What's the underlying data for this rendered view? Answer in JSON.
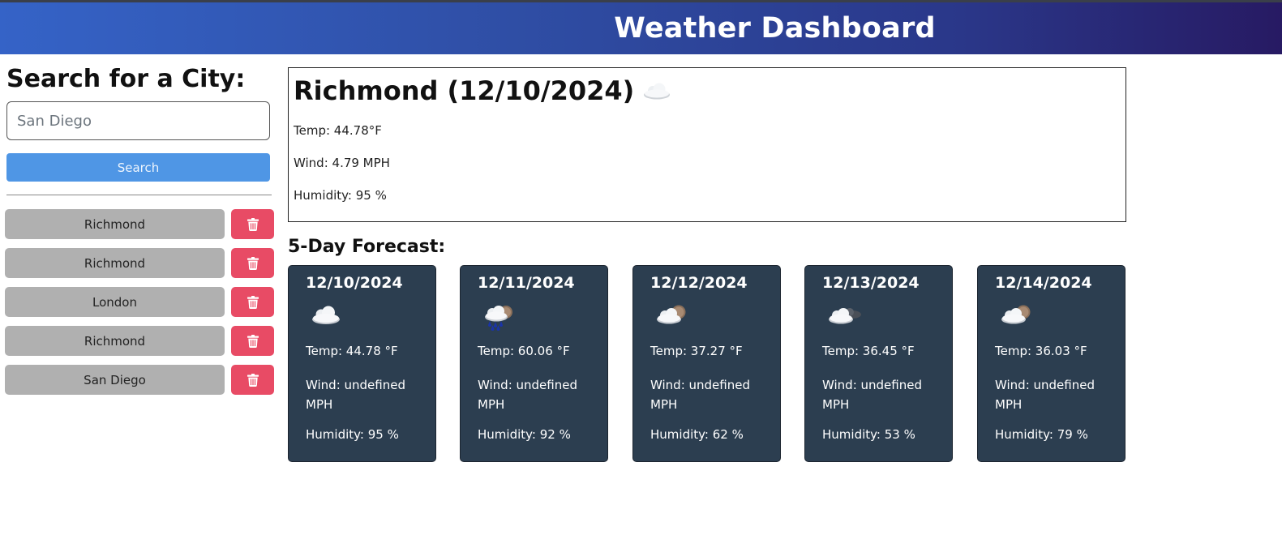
{
  "header": {
    "title": "Weather Dashboard"
  },
  "sidebar": {
    "title": "Search for a City:",
    "search": {
      "value": "",
      "placeholder": "San Diego"
    },
    "search_button": "Search",
    "history": [
      {
        "city": "Richmond"
      },
      {
        "city": "Richmond"
      },
      {
        "city": "London"
      },
      {
        "city": "Richmond"
      },
      {
        "city": "San Diego"
      }
    ]
  },
  "today": {
    "heading": "Richmond (12/10/2024)",
    "icon": "cloud-icon",
    "temp": "Temp: 44.78°F",
    "wind": "Wind: 4.79 MPH",
    "humidity": "Humidity: 95 %"
  },
  "forecast": {
    "title": "5-Day Forecast:",
    "days": [
      {
        "date": "12/10/2024",
        "icon": "cloud-icon",
        "temp": "Temp: 44.78 °F",
        "wind": "Wind: undefined MPH",
        "humidity": "Humidity: 95 %"
      },
      {
        "date": "12/11/2024",
        "icon": "rain-cloud-icon",
        "temp": "Temp: 60.06 °F",
        "wind": "Wind: undefined MPH",
        "humidity": "Humidity: 92 %"
      },
      {
        "date": "12/12/2024",
        "icon": "cloud-sun-icon",
        "temp": "Temp: 37.27 °F",
        "wind": "Wind: undefined MPH",
        "humidity": "Humidity: 62 %"
      },
      {
        "date": "12/13/2024",
        "icon": "cloud-dark-icon",
        "temp": "Temp: 36.45 °F",
        "wind": "Wind: undefined MPH",
        "humidity": "Humidity: 53 %"
      },
      {
        "date": "12/14/2024",
        "icon": "cloud-sun-icon",
        "temp": "Temp: 36.03 °F",
        "wind": "Wind: undefined MPH",
        "humidity": "Humidity: 79 %"
      }
    ]
  },
  "colors": {
    "header_start": "#3563c7",
    "header_end": "#271a63",
    "search_button": "#4f96e5",
    "history_button": "#b0b0b0",
    "delete_button": "#e84b65",
    "card_background": "#2c3e50"
  }
}
